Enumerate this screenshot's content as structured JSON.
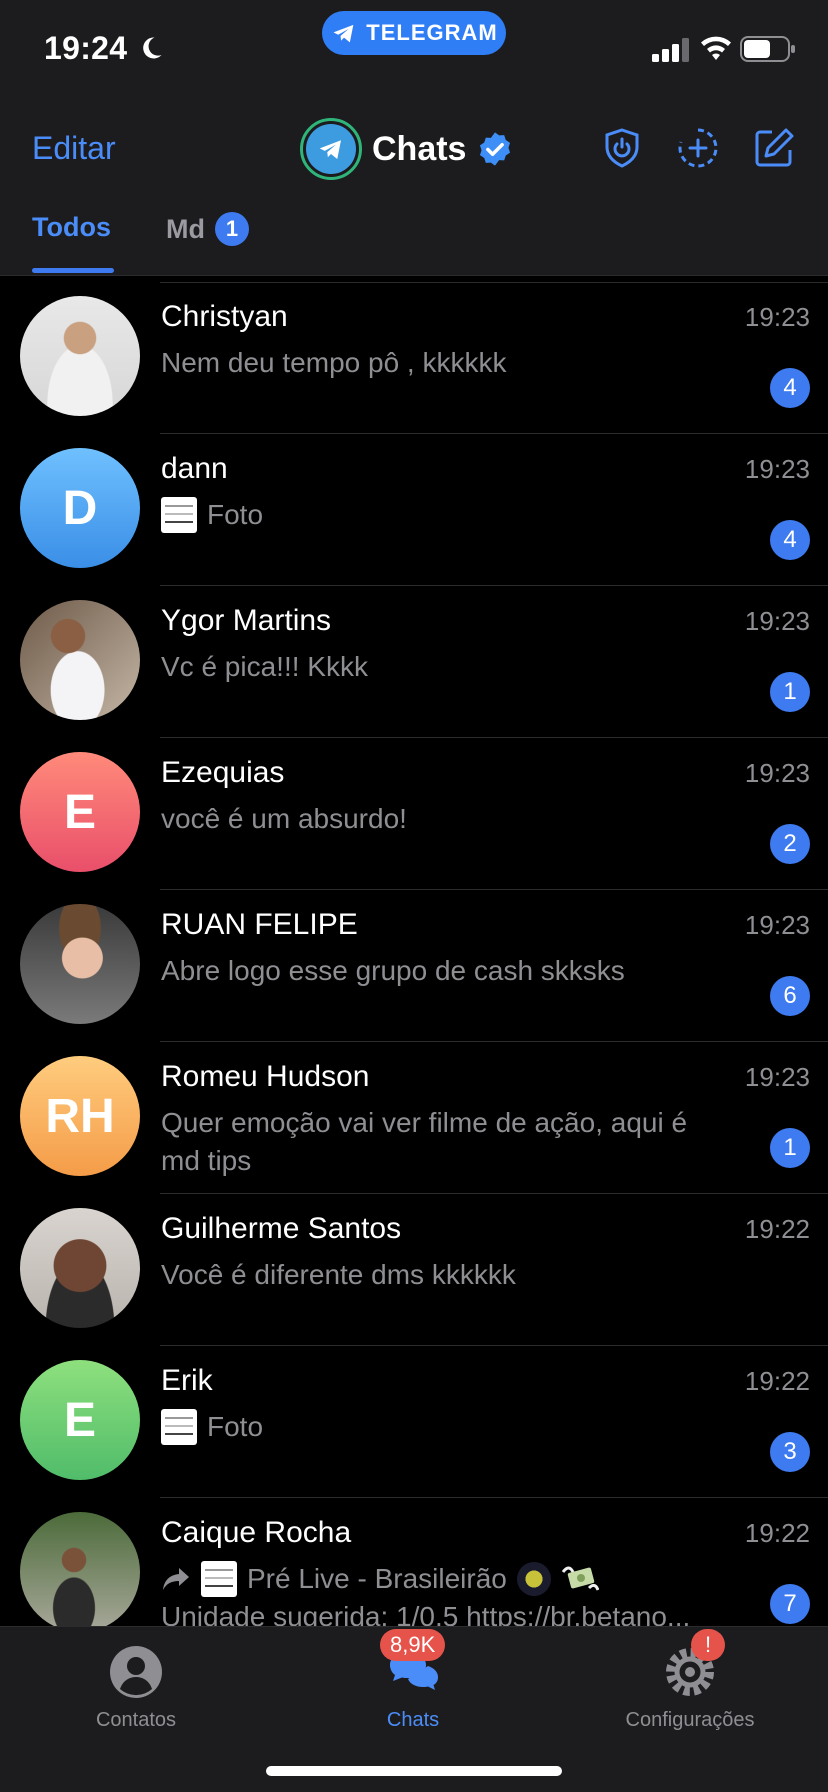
{
  "status_bar": {
    "time": "19:24",
    "pill_label": "TELEGRAM"
  },
  "header": {
    "edit_label": "Editar",
    "title": "Chats",
    "tabs": [
      {
        "label": "Todos",
        "badge": ""
      },
      {
        "label": "Md",
        "badge": "1"
      }
    ]
  },
  "chats": [
    {
      "name": "Christyan",
      "time": "19:23",
      "message": "Nem deu tempo pô , kkkkkk",
      "unread": "4"
    },
    {
      "name": "dann",
      "time": "19:23",
      "message": "Foto",
      "unread": "4",
      "avatar_initials": "D"
    },
    {
      "name": "Ygor Martins",
      "time": "19:23",
      "message": "Vc é pica!!! Kkkk",
      "unread": "1"
    },
    {
      "name": "Ezequias",
      "time": "19:23",
      "message": "você é um absurdo!",
      "unread": "2",
      "avatar_initials": "E"
    },
    {
      "name": "RUAN FELIPE",
      "time": "19:23",
      "message": "Abre logo esse grupo de cash skksks",
      "unread": "6"
    },
    {
      "name": "Romeu Hudson",
      "time": "19:23",
      "message_line1": "Quer emoção vai ver filme de ação, aqui é",
      "message_line2": "md tips",
      "unread": "1",
      "avatar_initials": "RH"
    },
    {
      "name": "Guilherme Santos",
      "time": "19:22",
      "message": "Você é diferente dms kkkkkk",
      "unread": ""
    },
    {
      "name": "Erik",
      "time": "19:22",
      "message": "Foto",
      "unread": "3",
      "avatar_initials": "E"
    },
    {
      "name": "Caique Rocha",
      "time": "19:22",
      "message_line1": "Pré Live  -  Brasileirão",
      "message_line2": "Unidade sugerida: 1/0.5 https://br.betano...",
      "unread": "7"
    }
  ],
  "tabbar": {
    "items": [
      {
        "label": "Contatos",
        "badge": ""
      },
      {
        "label": "Chats",
        "badge": "8,9K"
      },
      {
        "label": "Configurações",
        "badge": "!"
      }
    ]
  },
  "colors": {
    "accent": "#4b8df8",
    "badge": "#3e7bf0",
    "alert": "#e5534b",
    "background": "#000000",
    "bar": "#1c1c1e"
  }
}
